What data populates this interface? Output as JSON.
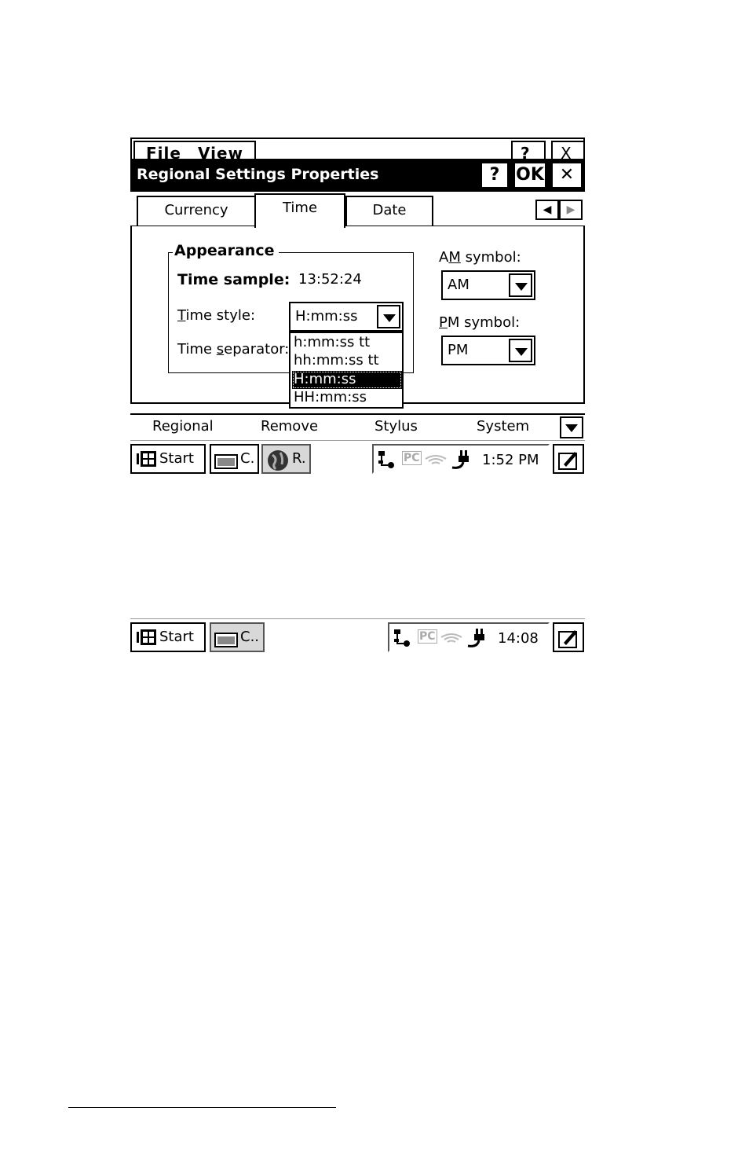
{
  "screen1": {
    "menu_behind": {
      "file": "File",
      "view": "View",
      "help": "?",
      "close": "X"
    },
    "titlebar": {
      "title": "Regional Settings Properties",
      "help_label": "?",
      "ok_label": "OK",
      "close_label": "✕"
    },
    "tabs": [
      {
        "label": "Currency"
      },
      {
        "label": "Time",
        "active": true
      },
      {
        "label": "Date"
      }
    ],
    "appearance": {
      "group_label": "Appearance",
      "sample_label": "Time sample:",
      "sample_value": "13:52:24",
      "style_label_pre": "",
      "style_label_u": "T",
      "style_label_post": "ime style:",
      "style_value": "H:mm:ss",
      "separator_label_pre": "Time ",
      "separator_label_u": "s",
      "separator_label_post": "eparator:",
      "style_options": [
        "h:mm:ss tt",
        "hh:mm:ss tt",
        "H:mm:ss",
        "HH:mm:ss"
      ],
      "style_selected_index": 2
    },
    "am": {
      "label_pre": "A",
      "label_u": "M",
      "label_post": " symbol:",
      "value": "AM"
    },
    "pm": {
      "label_pre": "",
      "label_u": "P",
      "label_post": "M symbol:",
      "value": "PM"
    },
    "command_bar": [
      "Regional",
      "Remove",
      "Stylus",
      "System"
    ],
    "taskbar": {
      "start_label": "Start",
      "task1_label": "C.",
      "task2_label": "R.",
      "pc_label": "PC",
      "clock": "1:52 PM"
    }
  },
  "screen2": {
    "taskbar": {
      "start_label": "Start",
      "task1_label": "C..",
      "pc_label": "PC",
      "clock": "14:08"
    }
  }
}
